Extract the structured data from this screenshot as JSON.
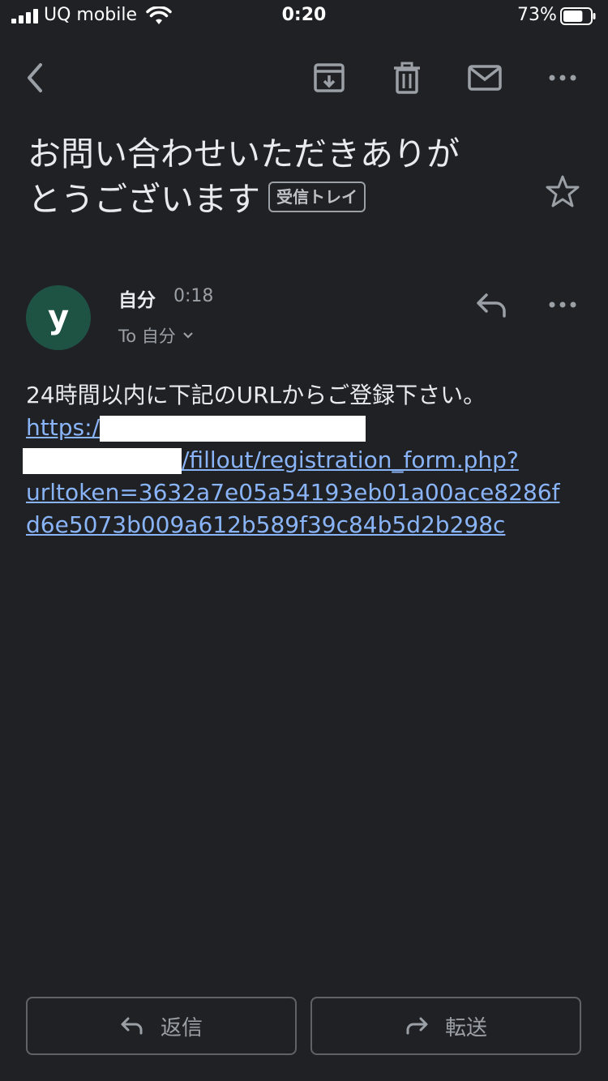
{
  "status_bar": {
    "carrier": "UQ mobile",
    "time": "0:20",
    "battery_percent": "73%",
    "battery_level": 0.73
  },
  "toolbar": {
    "back_icon": "chevron-left-icon",
    "archive_icon": "archive-icon",
    "delete_icon": "trash-icon",
    "mark_unread_icon": "mail-icon",
    "more_icon": "more-horizontal-icon"
  },
  "email": {
    "subject_line1": "お問い合わせいただきありが",
    "subject_line2": "とうございます",
    "label": "受信トレイ",
    "starred": false
  },
  "message": {
    "avatar_letter": "y",
    "avatar_color": "#1e5343",
    "sender": "自分",
    "time": "0:18",
    "recipients": "To 自分",
    "body_intro": "24時間以内に下記のURLからご登録下さい。",
    "link_prefix": "https:/",
    "link_middle": "/fillout/registration_form.php?",
    "link_token_line1": "urltoken=3632a7e05a54193eb01a00ace8286f",
    "link_token_line2": "d6e5073b009a612b589f39c84b5d2b298c"
  },
  "actions": {
    "reply_label": "返信",
    "forward_label": "転送"
  },
  "colors": {
    "background": "#202124",
    "link": "#8ab4f8",
    "secondary_text": "#9aa0a6"
  }
}
